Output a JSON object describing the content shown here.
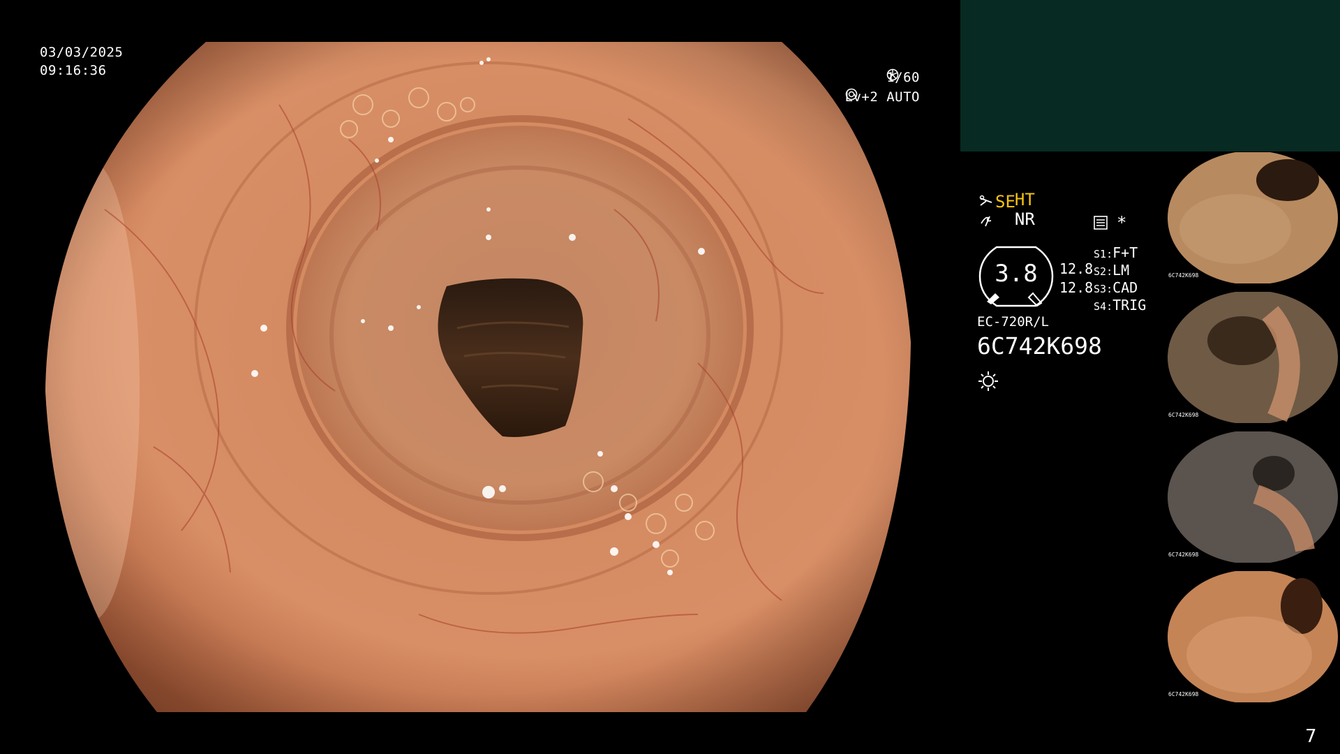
{
  "osd": {
    "date": "03/03/2025",
    "time": "09:16:36",
    "shutter": "1/60",
    "level": "Lv+2 AUTO"
  },
  "panel": {
    "ht": "HT",
    "nr": "NR",
    "se": "SE",
    "gauge_value": "3.8",
    "gauge_right_1": "12.8",
    "gauge_right_2": "12.8",
    "switches": [
      {
        "key": "S1",
        "value": "F+T"
      },
      {
        "key": "S2",
        "value": "LM"
      },
      {
        "key": "S3",
        "value": "CAD"
      },
      {
        "key": "S4",
        "value": "TRIG"
      }
    ],
    "scope_model": "EC-720R/L",
    "serial": "6C742K698",
    "icons": [
      "scissors-icon",
      "lightning-icon",
      "settings-card-icon",
      "asterisk-icon",
      "sun-icon"
    ]
  },
  "thumbnails": [
    {
      "label": "6C742K698"
    },
    {
      "label": "6C742K698"
    },
    {
      "label": "6C742K698"
    },
    {
      "label": "6C742K698"
    }
  ],
  "page_number": "7",
  "colors": {
    "top_box": "#072a22",
    "accent_yellow": "#f5c313",
    "tissue": "#d07c55"
  }
}
